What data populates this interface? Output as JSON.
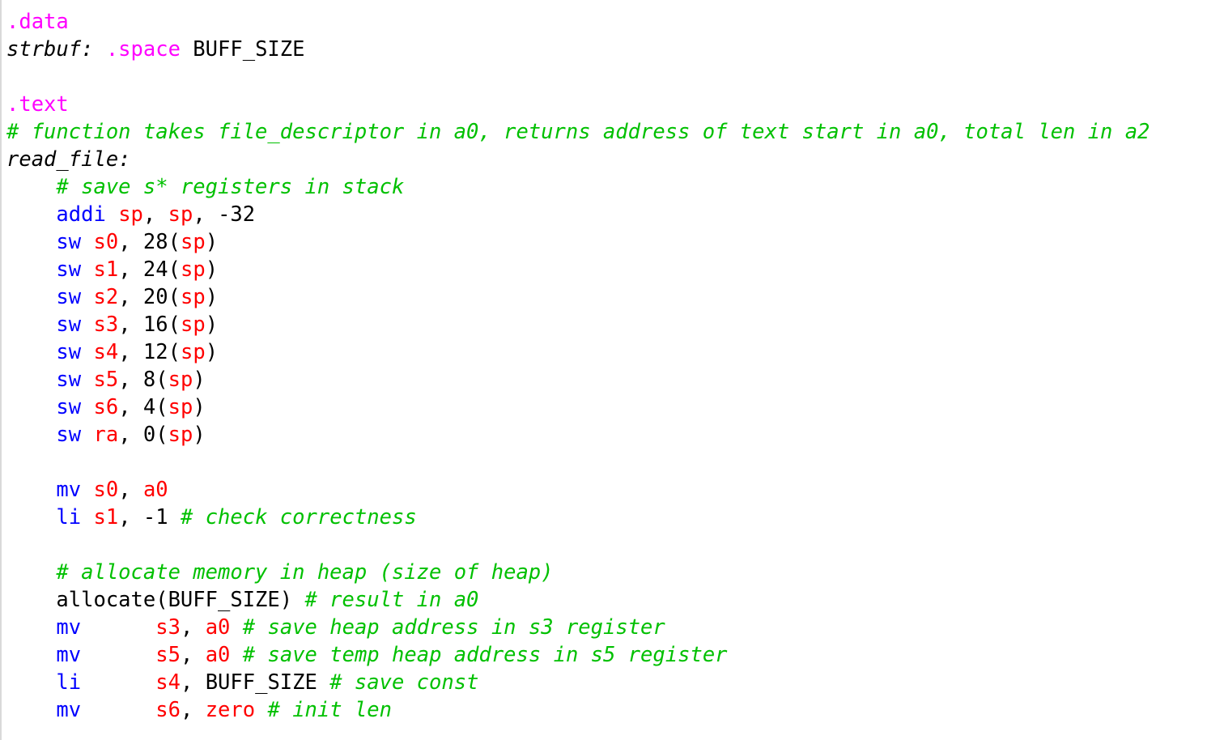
{
  "colors": {
    "instruction": "#0000ff",
    "register": "#ff0000",
    "directive": "#ff00ff",
    "comment": "#00c000",
    "text": "#000000",
    "background": "#ffffff"
  },
  "lines": [
    {
      "tokens": [
        {
          "t": "dir",
          "v": ".data"
        }
      ]
    },
    {
      "tokens": [
        {
          "t": "lbl",
          "v": "strbuf:"
        },
        {
          "t": "plain",
          "v": " "
        },
        {
          "t": "dir",
          "v": ".space"
        },
        {
          "t": "plain",
          "v": " BUFF_SIZE"
        }
      ]
    },
    {
      "tokens": []
    },
    {
      "tokens": [
        {
          "t": "dir",
          "v": ".text"
        }
      ]
    },
    {
      "tokens": [
        {
          "t": "cm",
          "v": "# function takes file_descriptor in a0, returns address of text start in a0, total len in a2"
        }
      ]
    },
    {
      "tokens": [
        {
          "t": "lbl",
          "v": "read_file:"
        }
      ]
    },
    {
      "tokens": [
        {
          "t": "plain",
          "v": "    "
        },
        {
          "t": "cm",
          "v": "# save s* registers in stack"
        }
      ]
    },
    {
      "tokens": [
        {
          "t": "plain",
          "v": "    "
        },
        {
          "t": "kw",
          "v": "addi"
        },
        {
          "t": "plain",
          "v": " "
        },
        {
          "t": "reg",
          "v": "sp"
        },
        {
          "t": "plain",
          "v": ", "
        },
        {
          "t": "reg",
          "v": "sp"
        },
        {
          "t": "plain",
          "v": ", -32"
        }
      ]
    },
    {
      "tokens": [
        {
          "t": "plain",
          "v": "    "
        },
        {
          "t": "kw",
          "v": "sw"
        },
        {
          "t": "plain",
          "v": " "
        },
        {
          "t": "reg",
          "v": "s0"
        },
        {
          "t": "plain",
          "v": ", 28("
        },
        {
          "t": "reg",
          "v": "sp"
        },
        {
          "t": "plain",
          "v": ")"
        }
      ]
    },
    {
      "tokens": [
        {
          "t": "plain",
          "v": "    "
        },
        {
          "t": "kw",
          "v": "sw"
        },
        {
          "t": "plain",
          "v": " "
        },
        {
          "t": "reg",
          "v": "s1"
        },
        {
          "t": "plain",
          "v": ", 24("
        },
        {
          "t": "reg",
          "v": "sp"
        },
        {
          "t": "plain",
          "v": ")"
        }
      ]
    },
    {
      "tokens": [
        {
          "t": "plain",
          "v": "    "
        },
        {
          "t": "kw",
          "v": "sw"
        },
        {
          "t": "plain",
          "v": " "
        },
        {
          "t": "reg",
          "v": "s2"
        },
        {
          "t": "plain",
          "v": ", 20("
        },
        {
          "t": "reg",
          "v": "sp"
        },
        {
          "t": "plain",
          "v": ")"
        }
      ]
    },
    {
      "tokens": [
        {
          "t": "plain",
          "v": "    "
        },
        {
          "t": "kw",
          "v": "sw"
        },
        {
          "t": "plain",
          "v": " "
        },
        {
          "t": "reg",
          "v": "s3"
        },
        {
          "t": "plain",
          "v": ", 16("
        },
        {
          "t": "reg",
          "v": "sp"
        },
        {
          "t": "plain",
          "v": ")"
        }
      ]
    },
    {
      "tokens": [
        {
          "t": "plain",
          "v": "    "
        },
        {
          "t": "kw",
          "v": "sw"
        },
        {
          "t": "plain",
          "v": " "
        },
        {
          "t": "reg",
          "v": "s4"
        },
        {
          "t": "plain",
          "v": ", 12("
        },
        {
          "t": "reg",
          "v": "sp"
        },
        {
          "t": "plain",
          "v": ")"
        }
      ]
    },
    {
      "tokens": [
        {
          "t": "plain",
          "v": "    "
        },
        {
          "t": "kw",
          "v": "sw"
        },
        {
          "t": "plain",
          "v": " "
        },
        {
          "t": "reg",
          "v": "s5"
        },
        {
          "t": "plain",
          "v": ", 8("
        },
        {
          "t": "reg",
          "v": "sp"
        },
        {
          "t": "plain",
          "v": ")"
        }
      ]
    },
    {
      "tokens": [
        {
          "t": "plain",
          "v": "    "
        },
        {
          "t": "kw",
          "v": "sw"
        },
        {
          "t": "plain",
          "v": " "
        },
        {
          "t": "reg",
          "v": "s6"
        },
        {
          "t": "plain",
          "v": ", 4("
        },
        {
          "t": "reg",
          "v": "sp"
        },
        {
          "t": "plain",
          "v": ")"
        }
      ]
    },
    {
      "tokens": [
        {
          "t": "plain",
          "v": "    "
        },
        {
          "t": "kw",
          "v": "sw"
        },
        {
          "t": "plain",
          "v": " "
        },
        {
          "t": "reg",
          "v": "ra"
        },
        {
          "t": "plain",
          "v": ", 0("
        },
        {
          "t": "reg",
          "v": "sp"
        },
        {
          "t": "plain",
          "v": ")"
        }
      ]
    },
    {
      "tokens": []
    },
    {
      "tokens": [
        {
          "t": "plain",
          "v": "    "
        },
        {
          "t": "kw",
          "v": "mv"
        },
        {
          "t": "plain",
          "v": " "
        },
        {
          "t": "reg",
          "v": "s0"
        },
        {
          "t": "plain",
          "v": ", "
        },
        {
          "t": "reg",
          "v": "a0"
        }
      ]
    },
    {
      "tokens": [
        {
          "t": "plain",
          "v": "    "
        },
        {
          "t": "kw",
          "v": "li"
        },
        {
          "t": "plain",
          "v": " "
        },
        {
          "t": "reg",
          "v": "s1"
        },
        {
          "t": "plain",
          "v": ", -1 "
        },
        {
          "t": "cm",
          "v": "# check correctness"
        }
      ]
    },
    {
      "tokens": []
    },
    {
      "tokens": [
        {
          "t": "plain",
          "v": "    "
        },
        {
          "t": "cm",
          "v": "# allocate memory in heap (size of heap)"
        }
      ]
    },
    {
      "tokens": [
        {
          "t": "plain",
          "v": "    allocate(BUFF_SIZE) "
        },
        {
          "t": "cm",
          "v": "# result in a0"
        }
      ]
    },
    {
      "tokens": [
        {
          "t": "plain",
          "v": "    "
        },
        {
          "t": "kw",
          "v": "mv"
        },
        {
          "t": "plain",
          "v": "      "
        },
        {
          "t": "reg",
          "v": "s3"
        },
        {
          "t": "plain",
          "v": ", "
        },
        {
          "t": "reg",
          "v": "a0"
        },
        {
          "t": "plain",
          "v": " "
        },
        {
          "t": "cm",
          "v": "# save heap address in s3 register"
        }
      ]
    },
    {
      "tokens": [
        {
          "t": "plain",
          "v": "    "
        },
        {
          "t": "kw",
          "v": "mv"
        },
        {
          "t": "plain",
          "v": "      "
        },
        {
          "t": "reg",
          "v": "s5"
        },
        {
          "t": "plain",
          "v": ", "
        },
        {
          "t": "reg",
          "v": "a0"
        },
        {
          "t": "plain",
          "v": " "
        },
        {
          "t": "cm",
          "v": "# save temp heap address in s5 register"
        }
      ]
    },
    {
      "tokens": [
        {
          "t": "plain",
          "v": "    "
        },
        {
          "t": "kw",
          "v": "li"
        },
        {
          "t": "plain",
          "v": "      "
        },
        {
          "t": "reg",
          "v": "s4"
        },
        {
          "t": "plain",
          "v": ", BUFF_SIZE "
        },
        {
          "t": "cm",
          "v": "# save const"
        }
      ]
    },
    {
      "tokens": [
        {
          "t": "plain",
          "v": "    "
        },
        {
          "t": "kw",
          "v": "mv"
        },
        {
          "t": "plain",
          "v": "      "
        },
        {
          "t": "reg",
          "v": "s6"
        },
        {
          "t": "plain",
          "v": ", "
        },
        {
          "t": "reg",
          "v": "zero"
        },
        {
          "t": "plain",
          "v": " "
        },
        {
          "t": "cm",
          "v": "# init len"
        }
      ]
    }
  ]
}
